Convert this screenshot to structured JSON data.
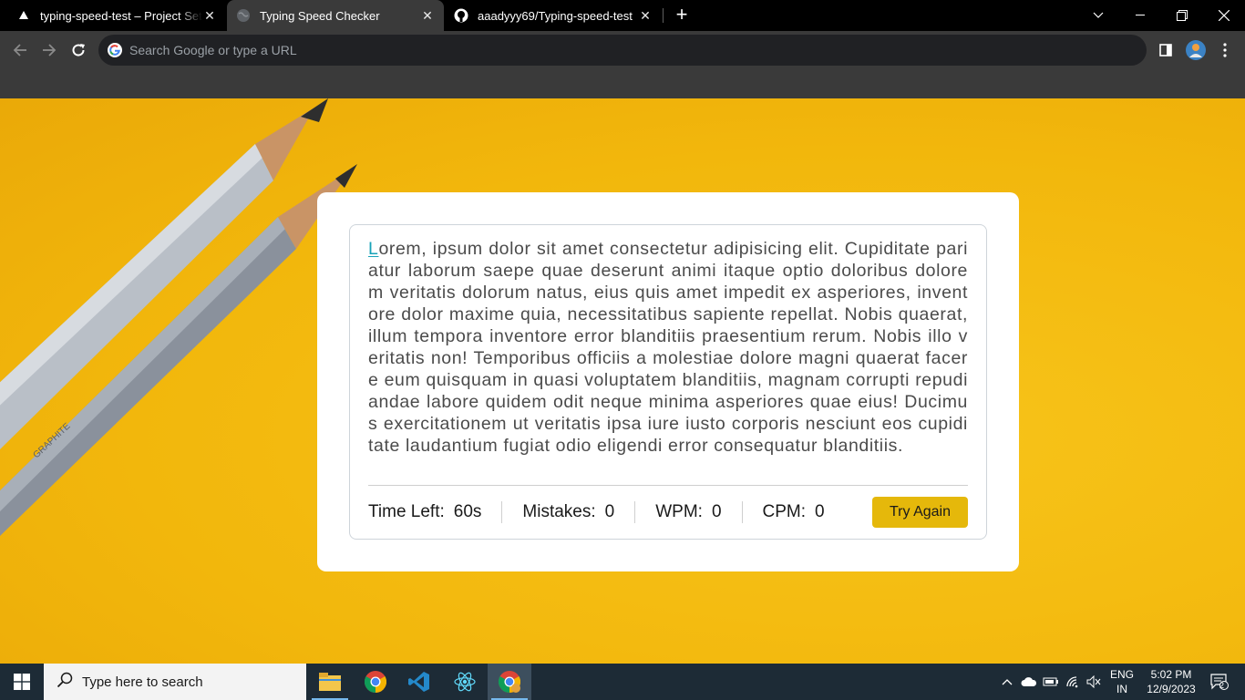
{
  "browser": {
    "tabs": [
      {
        "title": "typing-speed-test – Project Setti",
        "close": "✕"
      },
      {
        "title": "Typing Speed Checker",
        "close": "✕"
      },
      {
        "title": "aaadyyy69/Typing-speed-test",
        "close": "✕"
      }
    ],
    "new_tab": "+",
    "omnibox_placeholder": "Search Google or type a URL"
  },
  "app": {
    "first_letter": "L",
    "paragraph_rest": "orem, ipsum dolor sit amet consectetur adipisicing elit. Cupiditate pariatur laborum saepe quae deserunt animi itaque optio doloribus dolorem veritatis dolorum natus, eius quis amet impedit ex asperiores, inventore dolor maxime quia, necessitatibus sapiente repellat. Nobis quaerat, illum tempora inventore error blanditiis praesentium rerum. Nobis illo veritatis non! Temporibus officiis a molestiae dolore magni quaerat facere eum quisquam in quasi voluptatem blanditiis, magnam corrupti repudiandae labore quidem odit neque minima asperiores quae eius! Ducimus exercitationem ut veritatis ipsa iure iusto corporis nesciunt eos cupiditate laudantium fugiat odio eligendi error consequatur blanditiis.",
    "stats": {
      "time_label": "Time Left:",
      "time_value": "60s",
      "mistakes_label": "Mistakes:",
      "mistakes_value": "0",
      "wpm_label": "WPM:",
      "wpm_value": "0",
      "cpm_label": "CPM:",
      "cpm_value": "0"
    },
    "try_again": "Try Again"
  },
  "taskbar": {
    "search_text": "Type here to search",
    "language": "ENG",
    "region": "IN",
    "time": "5:02 PM",
    "date": "12/9/2023",
    "notification_count": "2"
  },
  "colors": {
    "background_yellow": "#f5bd12",
    "button_yellow": "#e5b80b",
    "active_letter": "#17a2b8"
  }
}
